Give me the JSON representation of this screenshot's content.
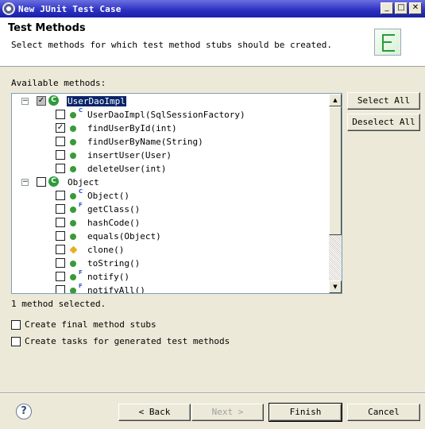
{
  "window": {
    "title": "New JUnit Test Case"
  },
  "header": {
    "title": "Test Methods",
    "description": "Select methods for which test method stubs should be created."
  },
  "available_label": "Available methods:",
  "tree": {
    "class1": {
      "name": "UserDaoImpl"
    },
    "class1_methods": [
      {
        "name": "UserDaoImpl(SqlSessionFactory)",
        "checked": false,
        "marker": "C"
      },
      {
        "name": "findUserById(int)",
        "checked": true
      },
      {
        "name": "findUserByName(String)",
        "checked": false
      },
      {
        "name": "insertUser(User)",
        "checked": false
      },
      {
        "name": "deleteUser(int)",
        "checked": false
      }
    ],
    "class2": {
      "name": "Object"
    },
    "class2_methods": [
      {
        "name": "Object()",
        "checked": false,
        "marker": "C"
      },
      {
        "name": "getClass()",
        "checked": false,
        "marker": "F"
      },
      {
        "name": "hashCode()",
        "checked": false
      },
      {
        "name": "equals(Object)",
        "checked": false
      },
      {
        "name": "clone()",
        "checked": false,
        "visibility": "protected"
      },
      {
        "name": "toString()",
        "checked": false
      },
      {
        "name": "notify()",
        "checked": false,
        "marker": "F"
      },
      {
        "name": "notifyAll()",
        "checked": false,
        "marker": "F"
      }
    ]
  },
  "buttons": {
    "select_all": "Select All",
    "deselect_all": "Deselect All",
    "back": "< Back",
    "next": "Next >",
    "finish": "Finish",
    "cancel": "Cancel"
  },
  "status": "1 method selected.",
  "options": {
    "final_stubs": "Create final method stubs",
    "tasks": "Create tasks for generated test methods"
  },
  "glyphs": {
    "check": "✓",
    "minus": "−",
    "minimize": "_",
    "maximize": "□",
    "close": "✕",
    "class_icon": "C",
    "up_arrow": "▲",
    "down_arrow": "▼",
    "help": "?"
  },
  "colors": {
    "selection": "#0a246a",
    "titlebar": "#2a2fc0",
    "method_dot": "#3a9a3a",
    "protected_dot": "#e6b020"
  }
}
